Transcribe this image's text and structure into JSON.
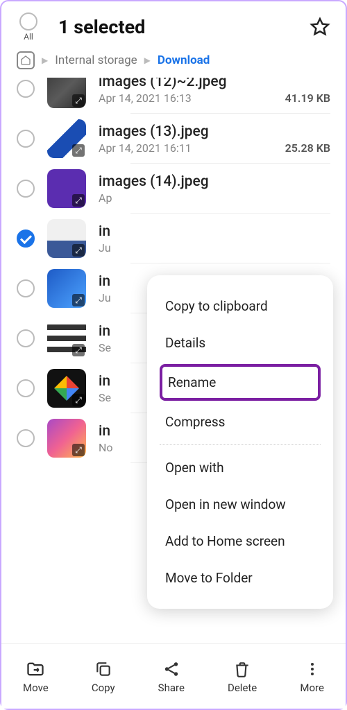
{
  "header": {
    "all_label": "All",
    "title": "1 selected"
  },
  "breadcrumb": {
    "internal": "Internal storage",
    "current": "Download"
  },
  "files": [
    {
      "name": "images (12)~2.jpeg",
      "date": "Apr 14, 2021 16:13",
      "size": "41.19 KB",
      "checked": false,
      "thumb": "th1"
    },
    {
      "name": "images (13).jpeg",
      "date": "Apr 14, 2021 16:11",
      "size": "25.28 KB",
      "checked": false,
      "thumb": "th2"
    },
    {
      "name": "images (14).jpeg",
      "date": "Ap",
      "size": "",
      "checked": false,
      "thumb": "th3"
    },
    {
      "name": "in",
      "date": "Ju",
      "size": "",
      "checked": true,
      "thumb": "th4"
    },
    {
      "name": "in",
      "date": "Ju",
      "size": "",
      "checked": false,
      "thumb": "th5"
    },
    {
      "name": "in",
      "date": "Se",
      "size": "",
      "checked": false,
      "thumb": "th6"
    },
    {
      "name": "in",
      "date": "Se",
      "size": "",
      "checked": false,
      "thumb": "th7"
    },
    {
      "name": "in",
      "date": "No",
      "size": "",
      "checked": false,
      "thumb": "th8"
    }
  ],
  "menu": {
    "items_top": [
      "Copy to clipboard",
      "Details",
      "Rename",
      "Compress"
    ],
    "items_bottom": [
      "Open with",
      "Open in new window",
      "Add to Home screen",
      "Move to Folder"
    ],
    "highlight_index": 2
  },
  "bottombar": {
    "move": "Move",
    "copy": "Copy",
    "share": "Share",
    "delete": "Delete",
    "more": "More"
  }
}
